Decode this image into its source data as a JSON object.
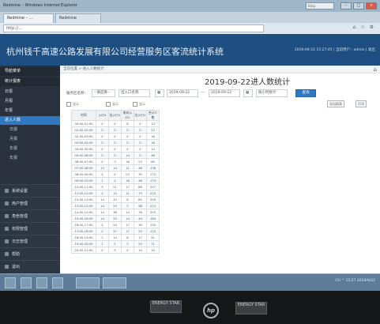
{
  "browser": {
    "title": "Redmine – Windows Internet Explorer",
    "search_placeholder": "Bing",
    "tabs": [
      "Redmine – ...",
      "Redmine"
    ],
    "address": "http://..."
  },
  "app": {
    "header_title": "杭州钱千高速公路发展有限公司经营服务区客流统计系统",
    "header_time": "2019-09-22 15:27:45 | 当前用户：admin | 退出"
  },
  "sidebar": {
    "items": [
      {
        "label": "导航菜单",
        "kind": "head"
      },
      {
        "label": "统计报表",
        "kind": "head"
      },
      {
        "label": "日报",
        "kind": "item"
      },
      {
        "label": "月报",
        "kind": "item"
      },
      {
        "label": "年报",
        "kind": "item"
      },
      {
        "label": "进入人数",
        "kind": "active"
      },
      {
        "label": "日报",
        "kind": "sub"
      },
      {
        "label": "月报",
        "kind": "sub"
      },
      {
        "label": "年报",
        "kind": "sub"
      },
      {
        "label": "年报",
        "kind": "sub"
      }
    ],
    "lower_items": [
      "系统设置",
      "用户管理",
      "角色管理",
      "权限管理",
      "日志管理",
      "帮助",
      "退出"
    ]
  },
  "main": {
    "breadcrumb": "当前位置 > 进入人数统计",
    "title": "2019-09-22进人数统计",
    "filters": {
      "area_label": "服务区名称：",
      "area_value": "--请选择--",
      "entrance_value": "出入口名称",
      "date_from": "2019-09-22",
      "date_sep": "—",
      "date_to": "2019-09-22",
      "period_value": "按小时统计",
      "query_button": "查询"
    },
    "options": [
      "显示",
      "显示",
      "显示"
    ],
    "toolbar": [
      "导出报表",
      "打印"
    ]
  },
  "table": {
    "headers": [
      "时间",
      "入口1",
      "出入口1",
      "南向入口1",
      "北入口1",
      "合计人数"
    ],
    "rows": [
      [
        "00:00-01:00",
        "0",
        "0",
        "6",
        "0",
        "12"
      ],
      [
        "01:00-02:00",
        "0",
        "0",
        "0",
        "0",
        "22"
      ],
      [
        "02:00-03:00",
        "0",
        "0",
        "0",
        "0",
        "16"
      ],
      [
        "03:00-04:00",
        "0",
        "0",
        "0",
        "0",
        "16"
      ],
      [
        "04:00-05:00",
        "0",
        "0",
        "0",
        "0",
        "14"
      ],
      [
        "05:00-06:00",
        "0",
        "0",
        "14",
        "0",
        "48"
      ],
      [
        "06:00-07:00",
        "0",
        "3",
        "16",
        "23",
        "69"
      ],
      [
        "07:00-08:00",
        "13",
        "14",
        "11",
        "48",
        "136"
      ],
      [
        "08:00-09:00",
        "4",
        "0",
        "23",
        "35",
        "172"
      ],
      [
        "09:00-10:00",
        "1",
        "4",
        "16",
        "48",
        "172"
      ],
      [
        "10:00-11:00",
        "5",
        "21",
        "17",
        "86",
        "207"
      ],
      [
        "11:00-12:00",
        "4",
        "15",
        "11",
        "73",
        "210"
      ],
      [
        "12:00-13:00",
        "14",
        "43",
        "6",
        "85",
        "205"
      ],
      [
        "13:00-14:00",
        "14",
        "23",
        "3",
        "98",
        "213"
      ],
      [
        "14:00-15:00",
        "14",
        "38",
        "14",
        "76",
        "203"
      ],
      [
        "15:00-16:00",
        "14",
        "25",
        "14",
        "49",
        "180"
      ],
      [
        "16:00-17:00",
        "4",
        "24",
        "17",
        "30",
        "150"
      ],
      [
        "17:00-18:00",
        "2",
        "27",
        "17",
        "20",
        "110"
      ],
      [
        "18:00-19:00",
        "2",
        "14",
        "8",
        "17",
        "91"
      ],
      [
        "19:00-20:00",
        "1",
        "5",
        "3",
        "20",
        "71"
      ],
      [
        "20:00-21:00",
        "0",
        "5",
        "0",
        "10",
        "34"
      ]
    ]
  },
  "taskbar": {
    "tray_text": "CH  ^  15:27  2019/9/22"
  },
  "monitor": {
    "brand": "hp",
    "labels": [
      "ENERGY STAR",
      "ENERGY STAR"
    ]
  }
}
